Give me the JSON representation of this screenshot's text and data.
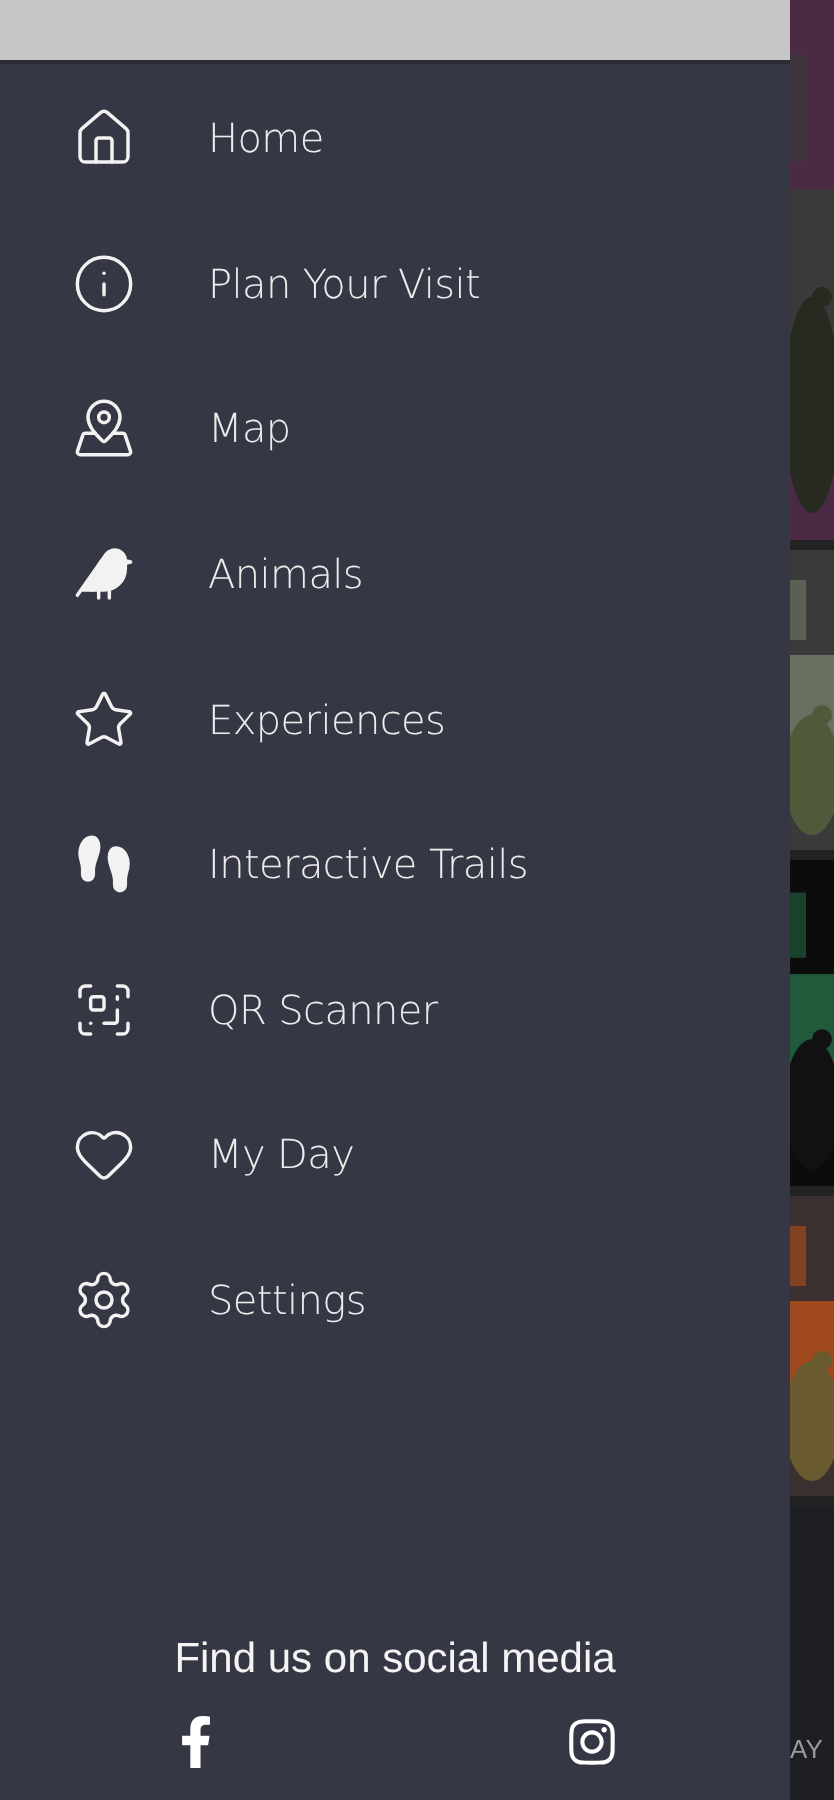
{
  "menu": [
    {
      "label": "Home"
    },
    {
      "label": "Plan Your Visit"
    },
    {
      "label": "Map"
    },
    {
      "label": "Animals"
    },
    {
      "label": "Experiences"
    },
    {
      "label": "Interactive Trails"
    },
    {
      "label": "QR Scanner"
    },
    {
      "label": "My Day"
    },
    {
      "label": "Settings"
    }
  ],
  "social": {
    "heading": "Find us on social media"
  },
  "background": {
    "tab_label": "AY"
  }
}
